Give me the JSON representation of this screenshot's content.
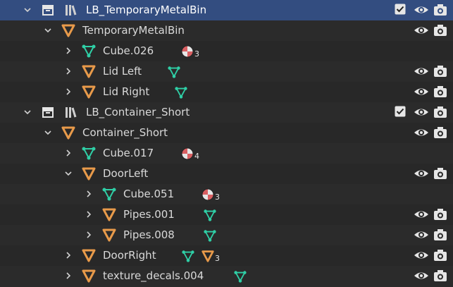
{
  "colors": {
    "mesh": "#2fcfa6",
    "empty": "#e89a4a",
    "selected_row": "#334d80",
    "material_red": "#d95f62"
  },
  "rows": [
    {
      "label": "LB_TemporaryMetalBin",
      "kind": "collection"
    },
    {
      "label": "TemporaryMetalBin",
      "kind": "empty"
    },
    {
      "label": "Cube.026",
      "kind": "mesh",
      "badge": "3"
    },
    {
      "label": "Lid Left",
      "kind": "empty"
    },
    {
      "label": "Lid Right",
      "kind": "empty"
    },
    {
      "label": "LB_Container_Short",
      "kind": "collection"
    },
    {
      "label": "Container_Short",
      "kind": "empty"
    },
    {
      "label": "Cube.017",
      "kind": "mesh",
      "badge": "4"
    },
    {
      "label": "DoorLeft",
      "kind": "empty"
    },
    {
      "label": "Cube.051",
      "kind": "mesh",
      "badge": "3"
    },
    {
      "label": "Pipes.001",
      "kind": "empty"
    },
    {
      "label": "Pipes.008",
      "kind": "empty"
    },
    {
      "label": "DoorRight",
      "kind": "empty",
      "badge": "3"
    },
    {
      "label": "texture_decals.004",
      "kind": "empty"
    }
  ],
  "icons": {
    "visibility": "eye-icon",
    "render": "camera-icon",
    "include": "checkbox-icon"
  }
}
